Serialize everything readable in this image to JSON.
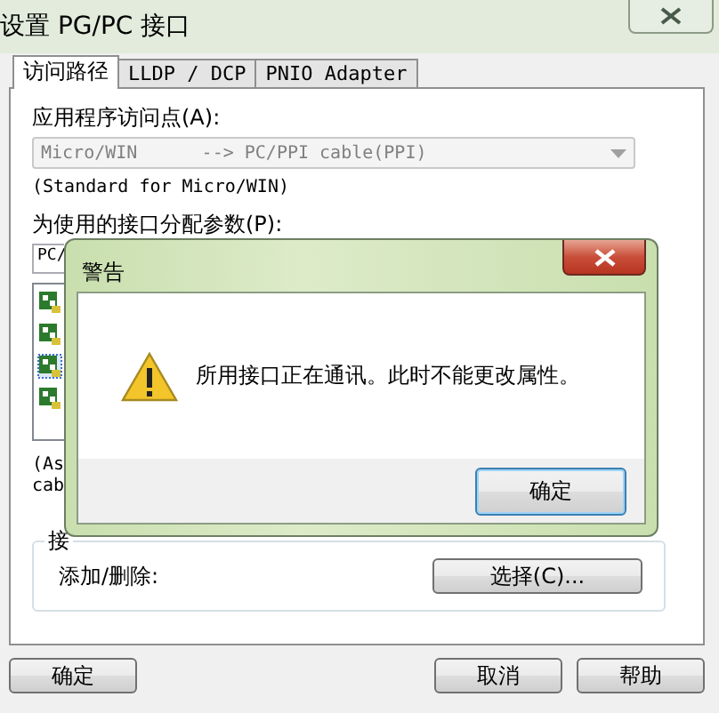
{
  "window": {
    "title": "设置 PG/PC 接口"
  },
  "tabs": [
    {
      "label": "访问路径",
      "selected": true
    },
    {
      "label": "LLDP / DCP",
      "selected": false
    },
    {
      "label": "PNIO Adapter",
      "selected": false
    }
  ],
  "access_point": {
    "label": "应用程序访问点(A):",
    "value": "Micro/WIN      --> PC/PPI cable(PPI)",
    "disabled": true,
    "description": "(Standard for Micro/WIN)"
  },
  "parameters": {
    "label": "为使用的接口分配参数(P):",
    "value": "PC/",
    "items": [
      {
        "focused": false
      },
      {
        "focused": false
      },
      {
        "focused": true
      },
      {
        "focused": false
      }
    ],
    "description_lines": [
      "(As",
      "cab"
    ]
  },
  "interfaces": {
    "label": "接",
    "add_remove_label": "添加/删除:",
    "select_button": "选择(C)..."
  },
  "buttons": [
    "确定",
    "取消",
    "帮助"
  ],
  "alert": {
    "title": "警告",
    "message": "所用接口正在通讯。此时不能更改属性。",
    "button": "确定"
  }
}
